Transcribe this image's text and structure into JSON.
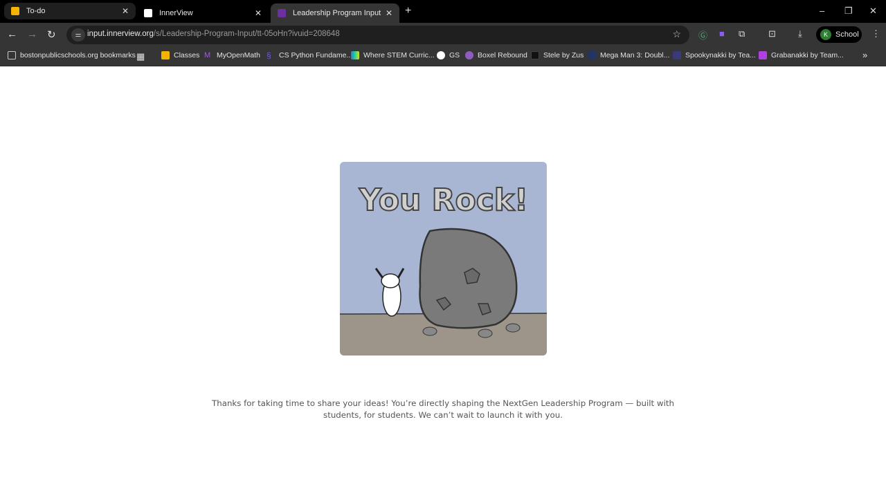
{
  "tabs": [
    {
      "title": "To-do",
      "color": "#f4b400"
    },
    {
      "title": "InnerView",
      "color": "#ffffff"
    },
    {
      "title": "Leadership Program Input",
      "color": "#6b2fa0",
      "active": true
    }
  ],
  "address": {
    "host": "input.innerview.org",
    "path": "/s/Leadership-Program-Input/tt-05oHn?ivuid=208648"
  },
  "profile": {
    "initial": "K",
    "name": "School"
  },
  "bookmarks": [
    {
      "label": "bostonpublicschools.org bookmarks"
    },
    {
      "label": "Classes",
      "color": "#f4b400"
    },
    {
      "label": "MyOpenMath",
      "color": "#7b3fb0"
    },
    {
      "label": "CS Python Fundame...",
      "color": "#5a4fd0"
    },
    {
      "label": "Where STEM Curric...",
      "color": "#2bb0a0"
    },
    {
      "label": "GS",
      "color": "#ffffff"
    },
    {
      "label": "Boxel Rebound",
      "color": "#8e5cc0"
    },
    {
      "label": "Stele by Zus",
      "color": "#111111"
    },
    {
      "label": "Mega Man 3: Doubl...",
      "color": "#223366"
    },
    {
      "label": "Spookynakki by Tea...",
      "color": "#3a3a7a"
    },
    {
      "label": "Grabanakki by Team...",
      "color": "#b040e0"
    }
  ],
  "main": {
    "image_title": "You Rock!",
    "message": "Thanks for taking  time to share your ideas! You’re directly shaping the NextGen Leadership Program — built with students, for students. We can’t wait to launch it with you."
  }
}
